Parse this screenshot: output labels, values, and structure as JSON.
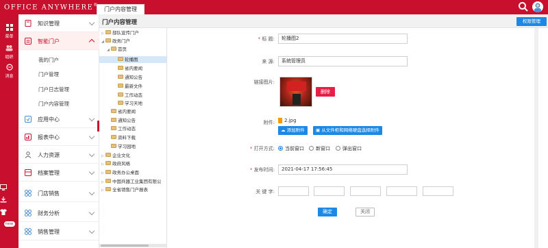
{
  "app": {
    "brand": "Office Anywhere",
    "brand_mark": "®",
    "tab_title": "门户内容管理"
  },
  "rail": {
    "menu_label": "菜单",
    "org_label": "组织",
    "msg_label": "消息",
    "badge": "new"
  },
  "nav": {
    "items": [
      {
        "label": "知识管理"
      },
      {
        "label": "智能门户"
      },
      {
        "label": "应用中心"
      },
      {
        "label": "报表中心"
      },
      {
        "label": "人力资源"
      },
      {
        "label": "档案管理"
      },
      {
        "label": "门店销售"
      },
      {
        "label": "财务分析"
      },
      {
        "label": "销售管理"
      }
    ],
    "sub_items": [
      "我的门户",
      "门户管理",
      "门户日志管理",
      "门户内容管理"
    ]
  },
  "content": {
    "title": "门户内容管理",
    "perm_button": "权限管理"
  },
  "tree": [
    {
      "label": "部队宣传门户",
      "toggle": "▷"
    },
    {
      "label": "政务门户",
      "toggle": "◢"
    },
    {
      "label": "首页",
      "toggle": "◢"
    },
    {
      "label": "轮播图",
      "toggle": ""
    },
    {
      "label": "省内要闻",
      "toggle": ""
    },
    {
      "label": "通知公告",
      "toggle": ""
    },
    {
      "label": "最新文件",
      "toggle": ""
    },
    {
      "label": "工作动态",
      "toggle": ""
    },
    {
      "label": "学习天地",
      "toggle": ""
    },
    {
      "label": "省内要闻",
      "toggle": ""
    },
    {
      "label": "通知公告",
      "toggle": ""
    },
    {
      "label": "工作动态",
      "toggle": ""
    },
    {
      "label": "资料下载",
      "toggle": ""
    },
    {
      "label": "学习园地",
      "toggle": ""
    },
    {
      "label": "企业文化",
      "toggle": "▷"
    },
    {
      "label": "政府风格",
      "toggle": "▷"
    },
    {
      "label": "政务办公桌面",
      "toggle": "▷"
    },
    {
      "label": "中国兵器工业集团有限公",
      "toggle": "▷"
    },
    {
      "label": "全省销售门户报表",
      "toggle": "▷"
    }
  ],
  "form": {
    "title_label": "标  题:",
    "title_value": "轮播图2",
    "source_label": "来  源:",
    "source_value": "系统管理员",
    "link_image_label": "链接图片:",
    "delete_button": "删除",
    "attachment_label": "附件:",
    "attachment_file": "2.jpg",
    "add_attachment": "添加附件",
    "choose_from_cabinet": "从文件柜和网络硬盘选择附件",
    "open_mode_label": "打开方式:",
    "open_modes": [
      "当前窗口",
      "新窗口",
      "弹出窗口"
    ],
    "publish_time_label": "发布时间:",
    "publish_time_value": "2021-04-17 17:56:45",
    "keywords_label": "关 键 字:",
    "confirm_button": "确定",
    "close_button": "关闭"
  },
  "colors": {
    "brand_red": "#c8102e",
    "accent_blue": "#1e88e5",
    "delete_pink": "#e91e47"
  }
}
